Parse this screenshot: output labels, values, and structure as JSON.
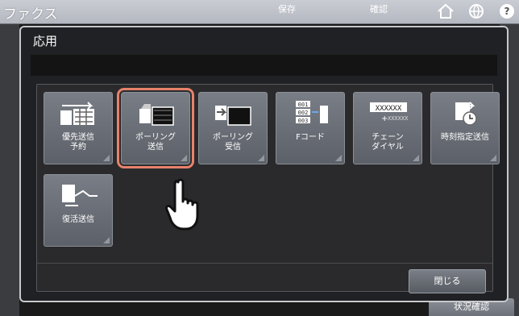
{
  "app": {
    "title": "ファクス",
    "tabs": [
      {
        "label": "保存"
      },
      {
        "label": "確認"
      }
    ],
    "status_tab": "状況確認"
  },
  "dialog": {
    "title": "応用",
    "message": "",
    "tiles": [
      {
        "label": "優先送信\n予約",
        "icon": "priority-transmission-icon",
        "selected": false
      },
      {
        "label": "ポーリング\n送信",
        "icon": "polling-transmit-icon",
        "selected": true
      },
      {
        "label": "ポーリング\n受信",
        "icon": "polling-receive-icon",
        "selected": false
      },
      {
        "label": "Fコード",
        "icon": "fcode-icon",
        "selected": false
      },
      {
        "label": "チェーン\nダイヤル",
        "icon": "chain-dial-icon",
        "selected": false
      },
      {
        "label": "時刻指定送信",
        "icon": "timer-transmission-icon",
        "selected": false
      },
      {
        "label": "復活送信",
        "icon": "recovery-transmission-icon",
        "selected": false
      }
    ],
    "close_label": "閉じる"
  },
  "colors": {
    "selection_outline": "#e8826a",
    "dialog_background": "#202124",
    "tile_background": "#6b7078"
  }
}
